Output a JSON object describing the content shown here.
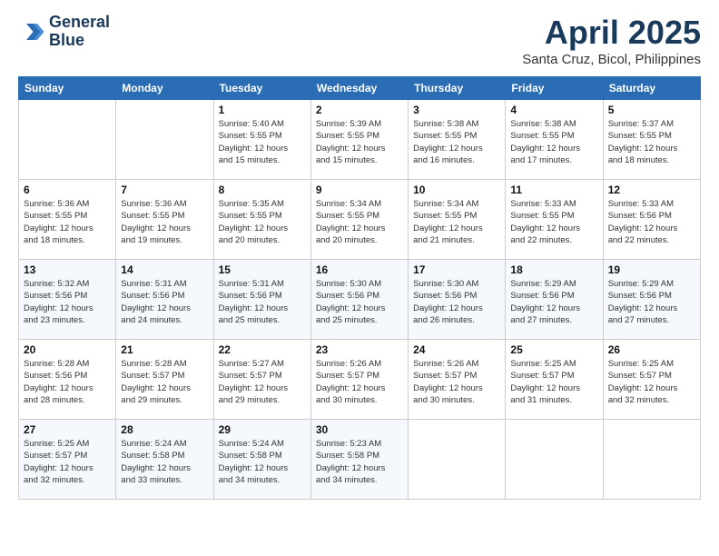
{
  "header": {
    "logo_line1": "General",
    "logo_line2": "Blue",
    "month": "April 2025",
    "location": "Santa Cruz, Bicol, Philippines"
  },
  "weekdays": [
    "Sunday",
    "Monday",
    "Tuesday",
    "Wednesday",
    "Thursday",
    "Friday",
    "Saturday"
  ],
  "weeks": [
    [
      {
        "day": "",
        "info": ""
      },
      {
        "day": "",
        "info": ""
      },
      {
        "day": "1",
        "info": "Sunrise: 5:40 AM\nSunset: 5:55 PM\nDaylight: 12 hours\nand 15 minutes."
      },
      {
        "day": "2",
        "info": "Sunrise: 5:39 AM\nSunset: 5:55 PM\nDaylight: 12 hours\nand 15 minutes."
      },
      {
        "day": "3",
        "info": "Sunrise: 5:38 AM\nSunset: 5:55 PM\nDaylight: 12 hours\nand 16 minutes."
      },
      {
        "day": "4",
        "info": "Sunrise: 5:38 AM\nSunset: 5:55 PM\nDaylight: 12 hours\nand 17 minutes."
      },
      {
        "day": "5",
        "info": "Sunrise: 5:37 AM\nSunset: 5:55 PM\nDaylight: 12 hours\nand 18 minutes."
      }
    ],
    [
      {
        "day": "6",
        "info": "Sunrise: 5:36 AM\nSunset: 5:55 PM\nDaylight: 12 hours\nand 18 minutes."
      },
      {
        "day": "7",
        "info": "Sunrise: 5:36 AM\nSunset: 5:55 PM\nDaylight: 12 hours\nand 19 minutes."
      },
      {
        "day": "8",
        "info": "Sunrise: 5:35 AM\nSunset: 5:55 PM\nDaylight: 12 hours\nand 20 minutes."
      },
      {
        "day": "9",
        "info": "Sunrise: 5:34 AM\nSunset: 5:55 PM\nDaylight: 12 hours\nand 20 minutes."
      },
      {
        "day": "10",
        "info": "Sunrise: 5:34 AM\nSunset: 5:55 PM\nDaylight: 12 hours\nand 21 minutes."
      },
      {
        "day": "11",
        "info": "Sunrise: 5:33 AM\nSunset: 5:55 PM\nDaylight: 12 hours\nand 22 minutes."
      },
      {
        "day": "12",
        "info": "Sunrise: 5:33 AM\nSunset: 5:56 PM\nDaylight: 12 hours\nand 22 minutes."
      }
    ],
    [
      {
        "day": "13",
        "info": "Sunrise: 5:32 AM\nSunset: 5:56 PM\nDaylight: 12 hours\nand 23 minutes."
      },
      {
        "day": "14",
        "info": "Sunrise: 5:31 AM\nSunset: 5:56 PM\nDaylight: 12 hours\nand 24 minutes."
      },
      {
        "day": "15",
        "info": "Sunrise: 5:31 AM\nSunset: 5:56 PM\nDaylight: 12 hours\nand 25 minutes."
      },
      {
        "day": "16",
        "info": "Sunrise: 5:30 AM\nSunset: 5:56 PM\nDaylight: 12 hours\nand 25 minutes."
      },
      {
        "day": "17",
        "info": "Sunrise: 5:30 AM\nSunset: 5:56 PM\nDaylight: 12 hours\nand 26 minutes."
      },
      {
        "day": "18",
        "info": "Sunrise: 5:29 AM\nSunset: 5:56 PM\nDaylight: 12 hours\nand 27 minutes."
      },
      {
        "day": "19",
        "info": "Sunrise: 5:29 AM\nSunset: 5:56 PM\nDaylight: 12 hours\nand 27 minutes."
      }
    ],
    [
      {
        "day": "20",
        "info": "Sunrise: 5:28 AM\nSunset: 5:56 PM\nDaylight: 12 hours\nand 28 minutes."
      },
      {
        "day": "21",
        "info": "Sunrise: 5:28 AM\nSunset: 5:57 PM\nDaylight: 12 hours\nand 29 minutes."
      },
      {
        "day": "22",
        "info": "Sunrise: 5:27 AM\nSunset: 5:57 PM\nDaylight: 12 hours\nand 29 minutes."
      },
      {
        "day": "23",
        "info": "Sunrise: 5:26 AM\nSunset: 5:57 PM\nDaylight: 12 hours\nand 30 minutes."
      },
      {
        "day": "24",
        "info": "Sunrise: 5:26 AM\nSunset: 5:57 PM\nDaylight: 12 hours\nand 30 minutes."
      },
      {
        "day": "25",
        "info": "Sunrise: 5:25 AM\nSunset: 5:57 PM\nDaylight: 12 hours\nand 31 minutes."
      },
      {
        "day": "26",
        "info": "Sunrise: 5:25 AM\nSunset: 5:57 PM\nDaylight: 12 hours\nand 32 minutes."
      }
    ],
    [
      {
        "day": "27",
        "info": "Sunrise: 5:25 AM\nSunset: 5:57 PM\nDaylight: 12 hours\nand 32 minutes."
      },
      {
        "day": "28",
        "info": "Sunrise: 5:24 AM\nSunset: 5:58 PM\nDaylight: 12 hours\nand 33 minutes."
      },
      {
        "day": "29",
        "info": "Sunrise: 5:24 AM\nSunset: 5:58 PM\nDaylight: 12 hours\nand 34 minutes."
      },
      {
        "day": "30",
        "info": "Sunrise: 5:23 AM\nSunset: 5:58 PM\nDaylight: 12 hours\nand 34 minutes."
      },
      {
        "day": "",
        "info": ""
      },
      {
        "day": "",
        "info": ""
      },
      {
        "day": "",
        "info": ""
      }
    ]
  ]
}
